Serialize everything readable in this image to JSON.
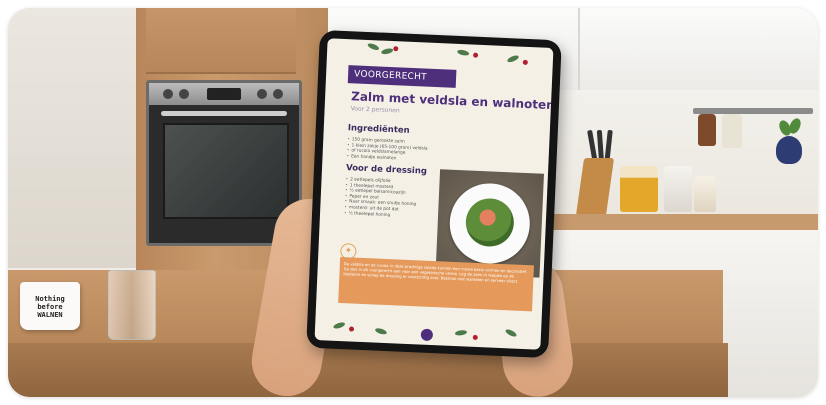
{
  "mug": {
    "text": "Nothing\nbefore\nWALNEN"
  },
  "recipe": {
    "category": "VOORGERECHT",
    "title": "Zalm met veldsla en walnoten",
    "serving": "Voor 2 personen",
    "ingredients_heading": "Ingrediënten",
    "ingredients": [
      "150 gram gerookte zalm",
      "1 klein zakje (65-100 gram) veldsla",
      "of rucola veldslamelange",
      "Een handje walnoten"
    ],
    "dressing_heading": "Voor de dressing",
    "dressing": [
      "2 eetlepels olijfolie",
      "1 theelepel mosterd",
      "½ eetlepel balsamicoazijn",
      "Peper en zout",
      "Naar smaak: een snufje honing",
      "mosterd- uit de pot dat",
      "½ theelepel honing"
    ],
    "tip": "De veldsla en de rucola in deze prachtige salade kunnen een mooie basis vormen en decoratief. Ga dan in dit voorgerecht aan voor een vegetarische versie. Leg de zalm in reepjes op de bladeren en schep de dressing er voorzichtig over. Bestrooi met walnoten en serveer direct."
  }
}
